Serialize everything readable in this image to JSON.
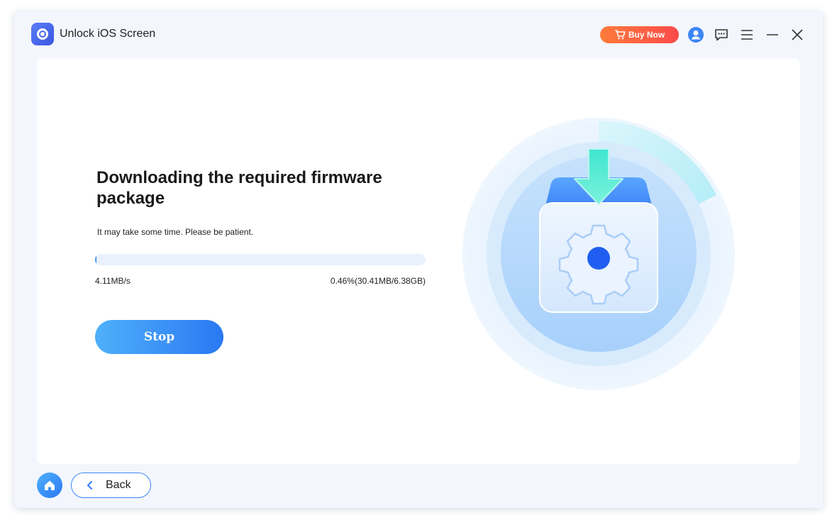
{
  "app": {
    "title": "Unlock iOS Screen"
  },
  "titlebar": {
    "buy_label": "Buy Now",
    "icons": [
      "cart-icon",
      "user-icon",
      "chat-icon",
      "menu-icon",
      "minimize-icon",
      "close-icon"
    ]
  },
  "main": {
    "heading": "Downloading the required firmware package",
    "subtext": "It may take some time. Please be patient.",
    "speed": "4.11MB/s",
    "progress_text": "0.46%(30.41MB/6.38GB)",
    "progress_percent": 0.46,
    "stop_label": "Stop"
  },
  "footer": {
    "back_label": "Back"
  },
  "colors": {
    "accent": "#2f7cf6",
    "buy": "#fb4a4a",
    "panel": "#ffffff",
    "window": "#f3f6fd"
  }
}
